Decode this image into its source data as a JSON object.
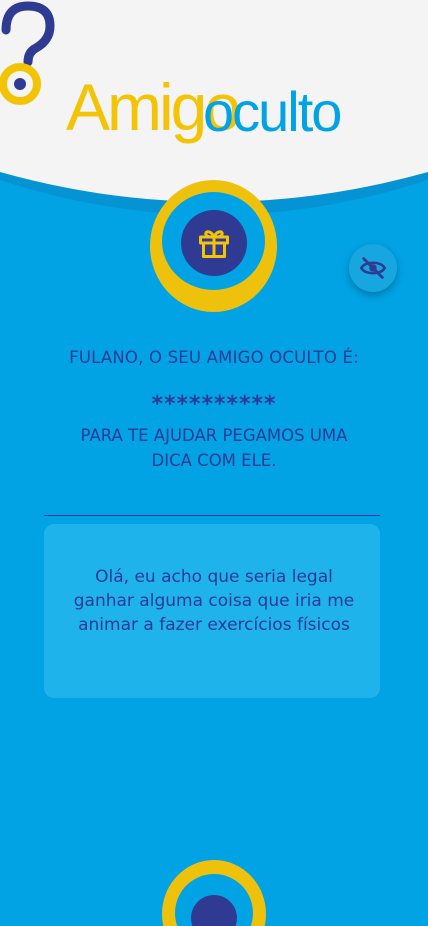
{
  "logo": {
    "word_amigo": "Amigo",
    "word_oculto": "oculto",
    "colors": {
      "yellow": "#F3C306",
      "blue": "#01A3E4",
      "navy": "#2F3A93"
    }
  },
  "icons": {
    "gift": "gift-icon",
    "visibility_toggle": "eye-off-icon"
  },
  "reveal": {
    "title": "FULANO, O SEU AMIGO OCULTO É:",
    "masked_name": "**********",
    "help_text": "PARA TE AJUDAR PEGAMOS UMA DICA COM ELE."
  },
  "hint": {
    "message": "Olá, eu acho que seria legal ganhar alguma coisa que iria me animar a fazer exercícios físicos"
  },
  "theme": {
    "background": "#01A3E4",
    "header_background": "#F4F4F4",
    "text_color": "#2C3A98",
    "accent_yellow": "#EEC20C"
  }
}
